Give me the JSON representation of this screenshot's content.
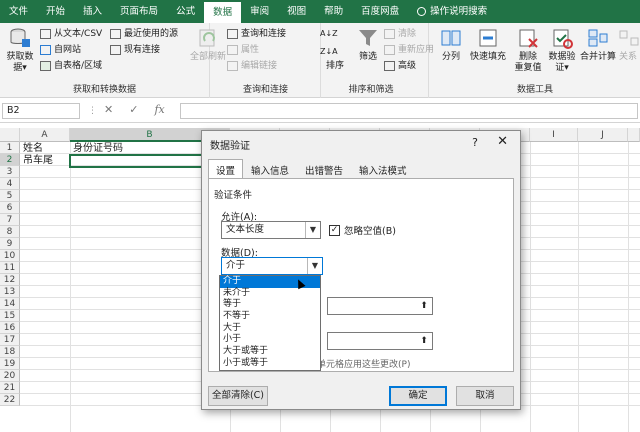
{
  "tabs": [
    "文件",
    "开始",
    "插入",
    "页面布局",
    "公式",
    "数据",
    "审阅",
    "视图",
    "帮助",
    "百度网盘"
  ],
  "tab_help": "操作说明搜索",
  "ribbon": {
    "get_data": {
      "big": "获取数\n据▾",
      "from_csv": "从文本/CSV",
      "from_web": "自网站",
      "from_table": "自表格/区域",
      "recent": "最近使用的源",
      "existing": "现有连接",
      "label": "获取和转换数据"
    },
    "queries": {
      "refresh_all": "全部刷新",
      "queries_conn": "查询和连接",
      "properties": "属性",
      "edit_links": "编辑链接",
      "label": "查询和连接"
    },
    "sort_filter": {
      "sort_az": "A↓Z",
      "sort_za": "Z↓A",
      "sort": "排序",
      "filter": "筛选",
      "clear": "清除",
      "reapply": "重新应用",
      "advanced": "高级",
      "label": "排序和筛选"
    },
    "tools": {
      "split": "分列",
      "flash": "快速填充",
      "dedupe": "删除\n重复值",
      "validation": "数据验\n证▾",
      "consolidate": "合并计算",
      "relation": "关系",
      "label": "数据工具"
    }
  },
  "formula_bar": {
    "name_box": "B2",
    "cancel": "✕",
    "enter": "✓",
    "fx": "fx"
  },
  "columns": [
    "A",
    "B",
    "C",
    "D",
    "E",
    "F",
    "G",
    "H",
    "I",
    "J"
  ],
  "rows": [
    "1",
    "2",
    "3",
    "4",
    "5",
    "6",
    "7",
    "8",
    "9",
    "10",
    "11",
    "12",
    "13",
    "14",
    "15",
    "16",
    "17",
    "18",
    "19",
    "20",
    "21",
    "22"
  ],
  "cells": {
    "A1": "姓名",
    "B1": "身份证号码",
    "A2": "吊车尾"
  },
  "dialog": {
    "title": "数据验证",
    "help": "?",
    "close": "✕",
    "tabs": [
      "设置",
      "输入信息",
      "出错警告",
      "输入法模式"
    ],
    "criteria_label": "验证条件",
    "allow_label": "允许(A):",
    "allow_value": "文本长度",
    "ignore_blank": "忽略空值(B)",
    "data_label": "数据(D):",
    "data_value": "介于",
    "apply_all": "单元格应用这些更改(P)",
    "clear_all": "全部清除(C)",
    "ok": "确定",
    "cancel": "取消",
    "dropdown_items": [
      "介于",
      "未介于",
      "等于",
      "不等于",
      "大于",
      "小于",
      "大于或等于",
      "小于或等于"
    ]
  }
}
